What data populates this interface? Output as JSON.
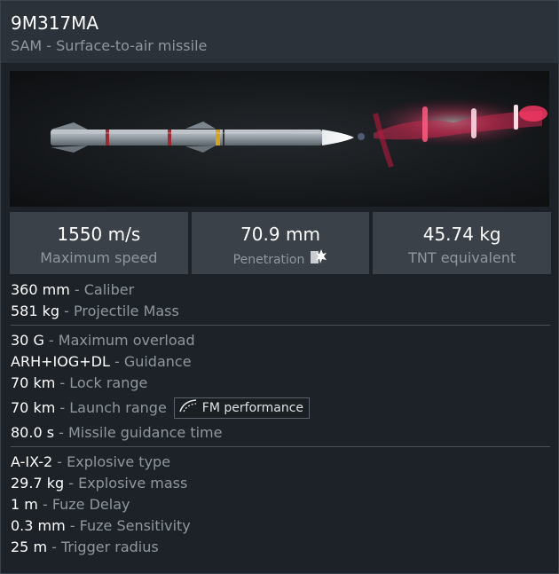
{
  "header": {
    "title": "9M317MA",
    "subtitle": "SAM - Surface-to-air missile"
  },
  "stats": {
    "speed": {
      "value": "1550 m/s",
      "label": "Maximum speed"
    },
    "penetration": {
      "value": "70.9 mm",
      "label": "Penetration"
    },
    "tnt": {
      "value": "45.74 kg",
      "label": "TNT equivalent"
    }
  },
  "group1": [
    {
      "value": "360 mm",
      "label": "Caliber"
    },
    {
      "value": "581 kg",
      "label": "Projectile Mass"
    }
  ],
  "group2": [
    {
      "value": "30 G",
      "label": "Maximum overload"
    },
    {
      "value": "ARH+IOG+DL",
      "label": "Guidance"
    },
    {
      "value": "70 km",
      "label": "Lock range"
    }
  ],
  "launch": {
    "value": "70 km",
    "label": "Launch range",
    "button": "FM performance"
  },
  "guidance_time": {
    "value": "80.0 s",
    "label": "Missile guidance time"
  },
  "group3": [
    {
      "value": "A-IX-2",
      "label": "Explosive type"
    },
    {
      "value": "29.7 kg",
      "label": "Explosive mass"
    },
    {
      "value": "1 m",
      "label": "Fuze Delay"
    },
    {
      "value": "0.3 mm",
      "label": "Fuze Sensitivity"
    },
    {
      "value": "25 m",
      "label": "Trigger radius"
    }
  ],
  "separator": " - ",
  "icons": {
    "penetration": "explosion-icon",
    "fm": "trajectory-curve-icon"
  }
}
